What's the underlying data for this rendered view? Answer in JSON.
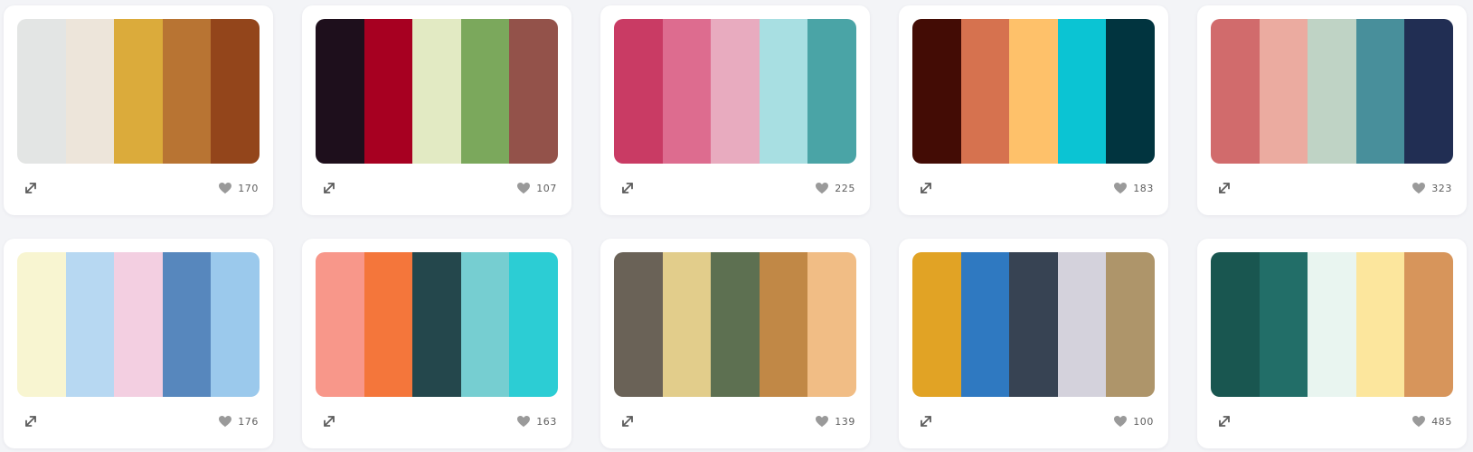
{
  "palettes": [
    {
      "colors": [
        "#e3e5e4",
        "#ede5da",
        "#dbab3b",
        "#b87433",
        "#93451b"
      ],
      "likes": "170"
    },
    {
      "colors": [
        "#1e0f1c",
        "#a70021",
        "#e2eac3",
        "#7ba85c",
        "#93524a"
      ],
      "likes": "107"
    },
    {
      "colors": [
        "#c93b64",
        "#dd6c8f",
        "#e8abbf",
        "#a8dfe2",
        "#4aa4a6"
      ],
      "likes": "225"
    },
    {
      "colors": [
        "#430c05",
        "#d6724f",
        "#fec16a",
        "#0bc4d3",
        "#01343f"
      ],
      "likes": "183"
    },
    {
      "colors": [
        "#d16b6c",
        "#ebaba0",
        "#bfd3c5",
        "#488f9b",
        "#212e53"
      ],
      "likes": "323"
    },
    {
      "colors": [
        "#f8f5d1",
        "#b7d8f2",
        "#f3cfe1",
        "#5787bd",
        "#9bc9ec"
      ],
      "likes": "176"
    },
    {
      "colors": [
        "#f8978a",
        "#f4763b",
        "#24474c",
        "#76ced1",
        "#2ccdd4"
      ],
      "likes": "163"
    },
    {
      "colors": [
        "#6a6257",
        "#e2cd8b",
        "#5d7051",
        "#c18846",
        "#f1bd85"
      ],
      "likes": "139"
    },
    {
      "colors": [
        "#e1a325",
        "#2f79c1",
        "#374353",
        "#d4d2dc",
        "#ae956a"
      ],
      "likes": "100"
    },
    {
      "colors": [
        "#195650",
        "#226e68",
        "#e9f5f0",
        "#fce69d",
        "#d7955b"
      ],
      "likes": "485"
    }
  ],
  "icons": {
    "expand": "expand-arrows-icon",
    "like": "heart-icon"
  },
  "colors": {
    "page_background": "#f3f4f7",
    "card_background": "#ffffff",
    "icon_color": "#5d5d5d",
    "heart_color": "#9a9a9a"
  }
}
